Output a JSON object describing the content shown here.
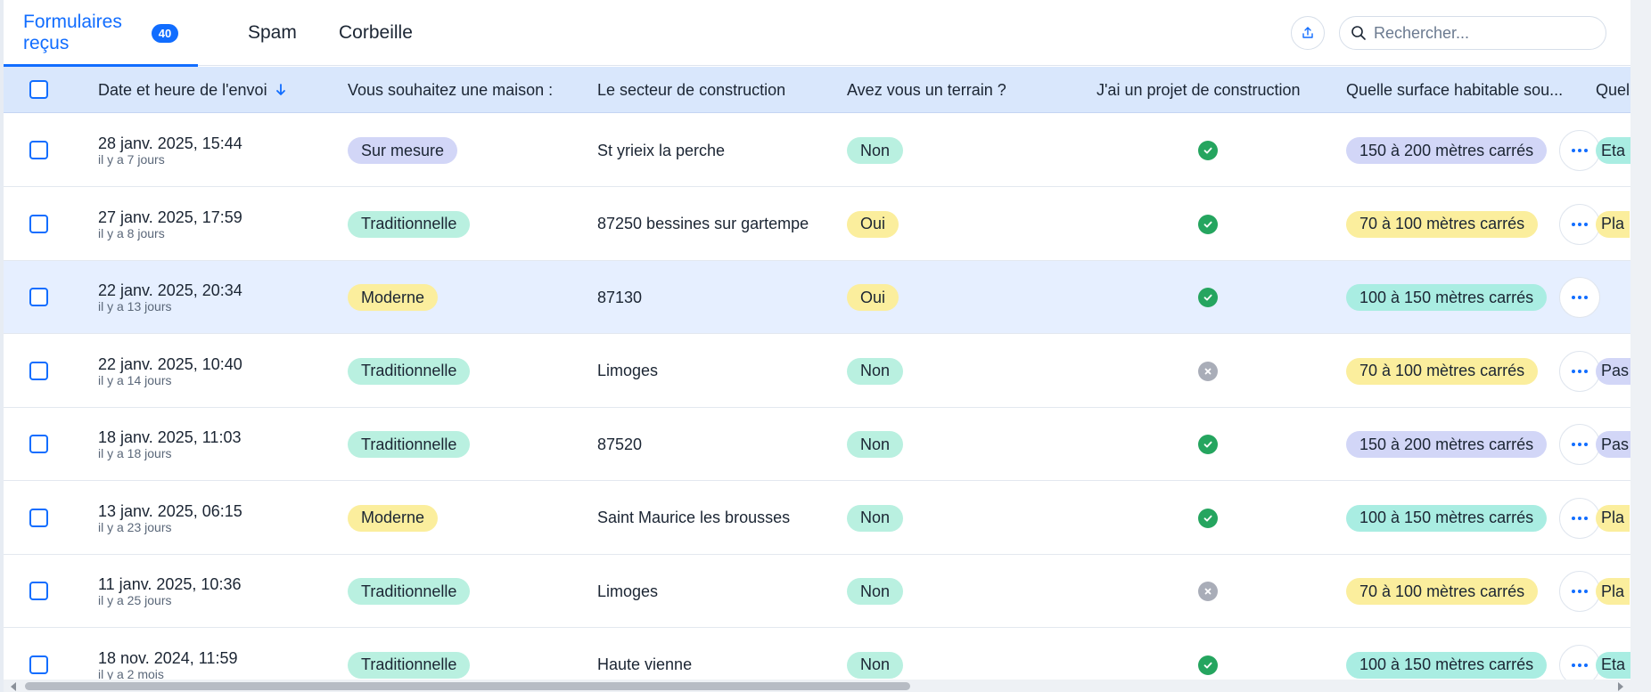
{
  "tabs": [
    {
      "label": "Formulaires reçus",
      "badge": "40",
      "active": true
    },
    {
      "label": "Spam"
    },
    {
      "label": "Corbeille"
    }
  ],
  "toolbar": {
    "export_icon": "upload-icon",
    "search_placeholder": "Rechercher..."
  },
  "columns": {
    "date": "Date et heure de l'envoi",
    "sort_icon": "arrow-down-icon",
    "maison": "Vous souhaitez une maison :",
    "secteur": "Le secteur de construction",
    "terrain": "Avez vous un terrain ?",
    "projet": "J'ai un projet de construction",
    "surface": "Quelle surface habitable sou...",
    "next": "Quel"
  },
  "colors": {
    "accent": "#116dff",
    "header_bg": "#d9e7fc",
    "ok": "#25a55f",
    "no": "#a9adb8"
  },
  "rows": [
    {
      "date": "28 janv. 2025, 15:44",
      "ago": "il y a 7 jours",
      "maison": "Sur mesure",
      "maison_color": "purple",
      "secteur": "St yrieix la perche",
      "terrain": "Non",
      "terrain_color": "teal",
      "projet": "yes",
      "surface": "150 à 200 mètres carrés",
      "surface_color": "purple",
      "next": "Eta",
      "next_color": "cyan",
      "highlight": false
    },
    {
      "date": "27 janv. 2025, 17:59",
      "ago": "il y a 8 jours",
      "maison": "Traditionnelle",
      "maison_color": "teal",
      "secteur": "87250 bessines sur gartempe",
      "terrain": "Oui",
      "terrain_color": "yellow",
      "projet": "yes",
      "surface": "70 à 100 mètres carrés",
      "surface_color": "yellow",
      "next": "Pla",
      "next_color": "yellow",
      "highlight": false
    },
    {
      "date": "22 janv. 2025, 20:34",
      "ago": "il y a 13 jours",
      "maison": "Moderne",
      "maison_color": "yellow",
      "secteur": "87130",
      "terrain": "Oui",
      "terrain_color": "yellow",
      "projet": "yes",
      "surface": "100 à 150 mètres carrés",
      "surface_color": "cyan",
      "next": "",
      "next_color": "",
      "highlight": true
    },
    {
      "date": "22 janv. 2025, 10:40",
      "ago": "il y a 14 jours",
      "maison": "Traditionnelle",
      "maison_color": "teal",
      "secteur": "Limoges",
      "terrain": "Non",
      "terrain_color": "teal",
      "projet": "no",
      "surface": "70 à 100 mètres carrés",
      "surface_color": "yellow",
      "next": "Pas",
      "next_color": "purple",
      "highlight": false
    },
    {
      "date": "18 janv. 2025, 11:03",
      "ago": "il y a 18 jours",
      "maison": "Traditionnelle",
      "maison_color": "teal",
      "secteur": "87520",
      "terrain": "Non",
      "terrain_color": "teal",
      "projet": "yes",
      "surface": "150 à 200 mètres carrés",
      "surface_color": "purple",
      "next": "Pas",
      "next_color": "purple",
      "highlight": false
    },
    {
      "date": "13 janv. 2025, 06:15",
      "ago": "il y a 23 jours",
      "maison": "Moderne",
      "maison_color": "yellow",
      "secteur": "Saint Maurice les brousses",
      "terrain": "Non",
      "terrain_color": "teal",
      "projet": "yes",
      "surface": "100 à 150 mètres carrés",
      "surface_color": "cyan",
      "next": "Pla",
      "next_color": "yellow",
      "highlight": false
    },
    {
      "date": "11 janv. 2025, 10:36",
      "ago": "il y a 25 jours",
      "maison": "Traditionnelle",
      "maison_color": "teal",
      "secteur": "Limoges",
      "terrain": "Non",
      "terrain_color": "teal",
      "projet": "no",
      "surface": "70 à 100 mètres carrés",
      "surface_color": "yellow",
      "next": "Pla",
      "next_color": "yellow",
      "highlight": false
    },
    {
      "date": "18 nov. 2024, 11:59",
      "ago": "il y a 2 mois",
      "maison": "Traditionnelle",
      "maison_color": "teal",
      "secteur": "Haute vienne",
      "terrain": "Non",
      "terrain_color": "teal",
      "projet": "yes",
      "surface": "100 à 150 mètres carrés",
      "surface_color": "cyan",
      "next": "Eta",
      "next_color": "cyan",
      "highlight": false
    }
  ],
  "scrollbar": {
    "horizontal_position": 0.0,
    "visible_fraction": 0.56
  }
}
